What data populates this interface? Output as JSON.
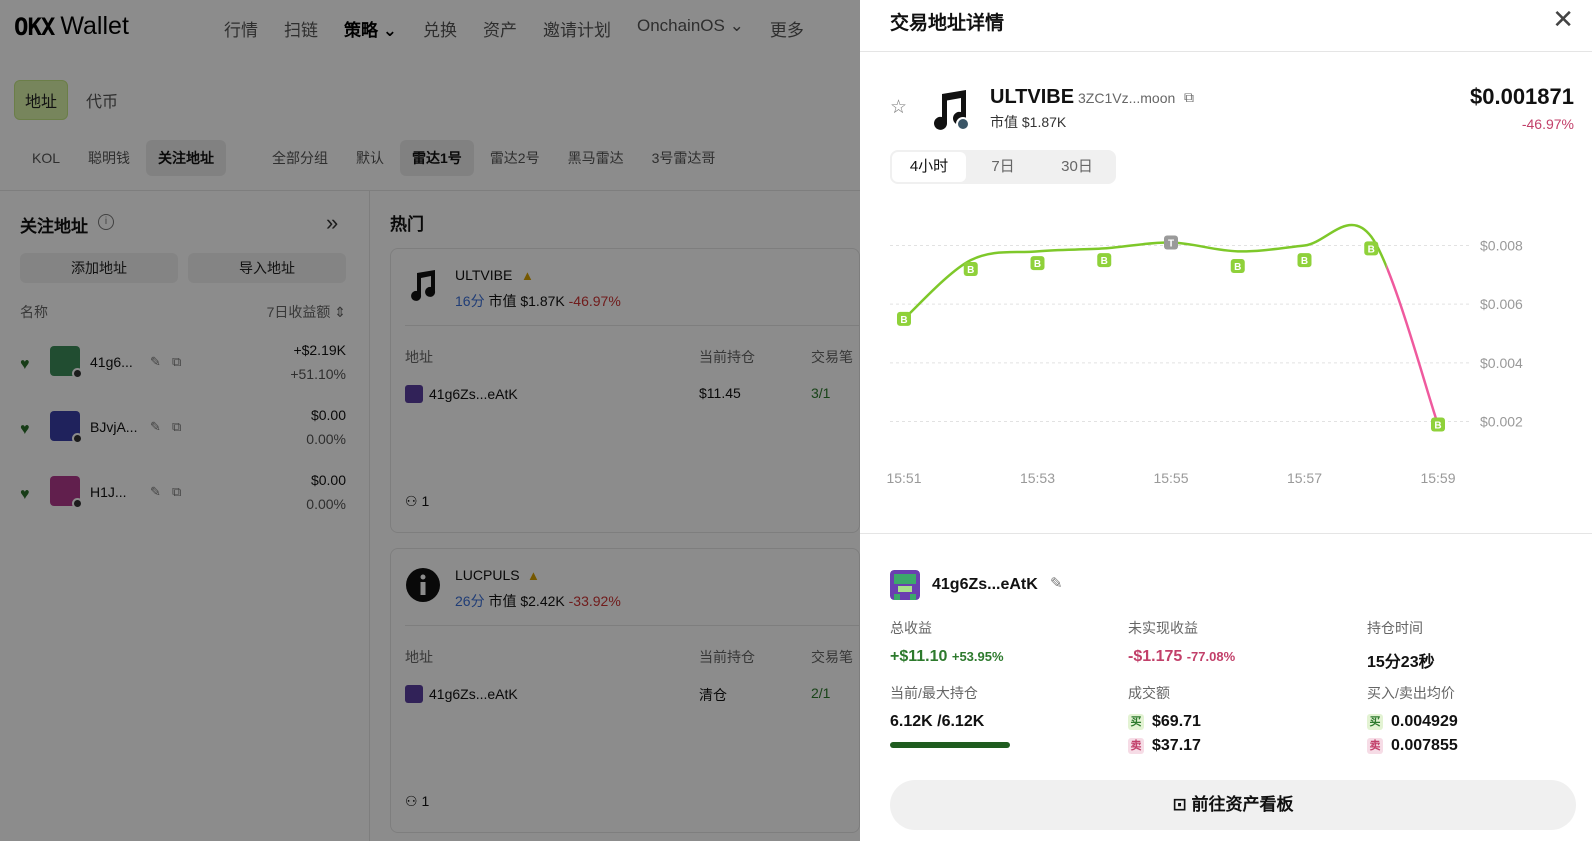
{
  "bg": {
    "logo_mark": "OKX",
    "logo_word": "Wallet",
    "nav": [
      "行情",
      "扫链",
      "策略 ⌄",
      "兑换",
      "资产",
      "邀请计划",
      "OnchainOS ⌄",
      "更多"
    ],
    "sub_tabs": {
      "address": "地址",
      "token": "代币"
    },
    "filters": [
      "KOL",
      "聪明钱",
      "关注地址",
      "全部分组",
      "默认",
      "雷达1号",
      "雷达2号",
      "黑马雷达",
      "3号雷达哥"
    ],
    "left": {
      "title": "关注地址",
      "add_btn": "添加地址",
      "import_btn": "导入地址",
      "col_name": "名称",
      "col_pnl": "7日收益额 ⇕",
      "rows": [
        {
          "name": "41g6...",
          "v1": "+$2.19K",
          "v2": "+51.10%"
        },
        {
          "name": "BJvjA...",
          "v1": "$0.00",
          "v2": "0.00%"
        },
        {
          "name": "H1J...",
          "v1": "$0.00",
          "v2": "0.00%"
        }
      ]
    },
    "mid": {
      "title": "热门",
      "cards": [
        {
          "name": "ULTVIBE",
          "age": "16分",
          "mcap": "市值 $1.87K",
          "chg": "-46.97%",
          "h_addr": "地址",
          "h_hold": "当前持仓",
          "h_tx": "交易笔",
          "addr": "41g6Zs...eAtK",
          "hold": "$11.45",
          "tx": "3/1",
          "count": "1"
        },
        {
          "name": "LUCPULS",
          "age": "26分",
          "mcap": "市值 $2.42K",
          "chg": "-33.92%",
          "h_addr": "地址",
          "h_hold": "当前持仓",
          "h_tx": "交易笔",
          "addr": "41g6Zs...eAtK",
          "hold": "清仓",
          "tx": "2/1",
          "count": "1"
        }
      ]
    }
  },
  "drawer": {
    "title": "交易地址详情",
    "token": {
      "name": "ULTVIBE",
      "addr": "3ZC1Vz...moon",
      "mcap": "市值 $1.87K",
      "price": "$0.001871",
      "change": "-46.97%"
    },
    "tabs": [
      "4小时",
      "7日",
      "30日"
    ],
    "wallet": {
      "name": "41g6Zs...eAtK"
    },
    "stats": {
      "total_pnl_label": "总收益",
      "total_pnl": "+$11.10",
      "total_pnl_pct": "+53.95%",
      "unreal_label": "未实现收益",
      "unreal": "-$1.175",
      "unreal_pct": "-77.08%",
      "hold_time_label": "持仓时间",
      "hold_time": "15分23秒",
      "holding_label": "当前/最大持仓",
      "holding": "6.12K /6.12K",
      "volume_label": "成交额",
      "buy_tag": "买",
      "sell_tag": "卖",
      "buy_vol": "$69.71",
      "sell_vol": "$37.17",
      "avg_label": "买入/卖出均价",
      "buy_avg": "0.004929",
      "sell_avg": "0.007855",
      "holding_ratio": 1.0
    },
    "cta": "前往资产看板"
  },
  "chart_data": {
    "type": "line",
    "x": [
      "15:51",
      "15:52",
      "15:53",
      "15:54",
      "15:55",
      "15:56",
      "15:57",
      "15:58",
      "15:59"
    ],
    "y_ticks": [
      "$0.008",
      "$0.006",
      "$0.004",
      "$0.002"
    ],
    "ylim": [
      0.0012,
      0.0088
    ],
    "series": [
      {
        "values": [
          0.0055,
          0.0075,
          0.0078,
          0.0079,
          0.0081,
          0.0078,
          0.008,
          0.0083,
          0.0019
        ]
      }
    ],
    "markers": [
      {
        "x": 0,
        "y": 0.0055,
        "label": "B"
      },
      {
        "x": 1,
        "y": 0.0075,
        "label": "B"
      },
      {
        "x": 2,
        "y": 0.0076,
        "label": "B"
      },
      {
        "x": 3,
        "y": 0.0077,
        "label": "B"
      },
      {
        "x": 4,
        "y": 0.0081,
        "label": "T"
      },
      {
        "x": 5,
        "y": 0.0075,
        "label": "B"
      },
      {
        "x": 6,
        "y": 0.0077,
        "label": "B"
      },
      {
        "x": 7,
        "y": 0.0079,
        "label": "B"
      },
      {
        "x": 9,
        "y": 0.0018,
        "label": "B"
      }
    ],
    "x_ticks": [
      "15:51",
      "15:53",
      "15:55",
      "15:57",
      "15:59"
    ],
    "colors": {
      "up": "#7ec82a",
      "down": "#ef5a9e",
      "marker": "#8fd13a"
    }
  }
}
